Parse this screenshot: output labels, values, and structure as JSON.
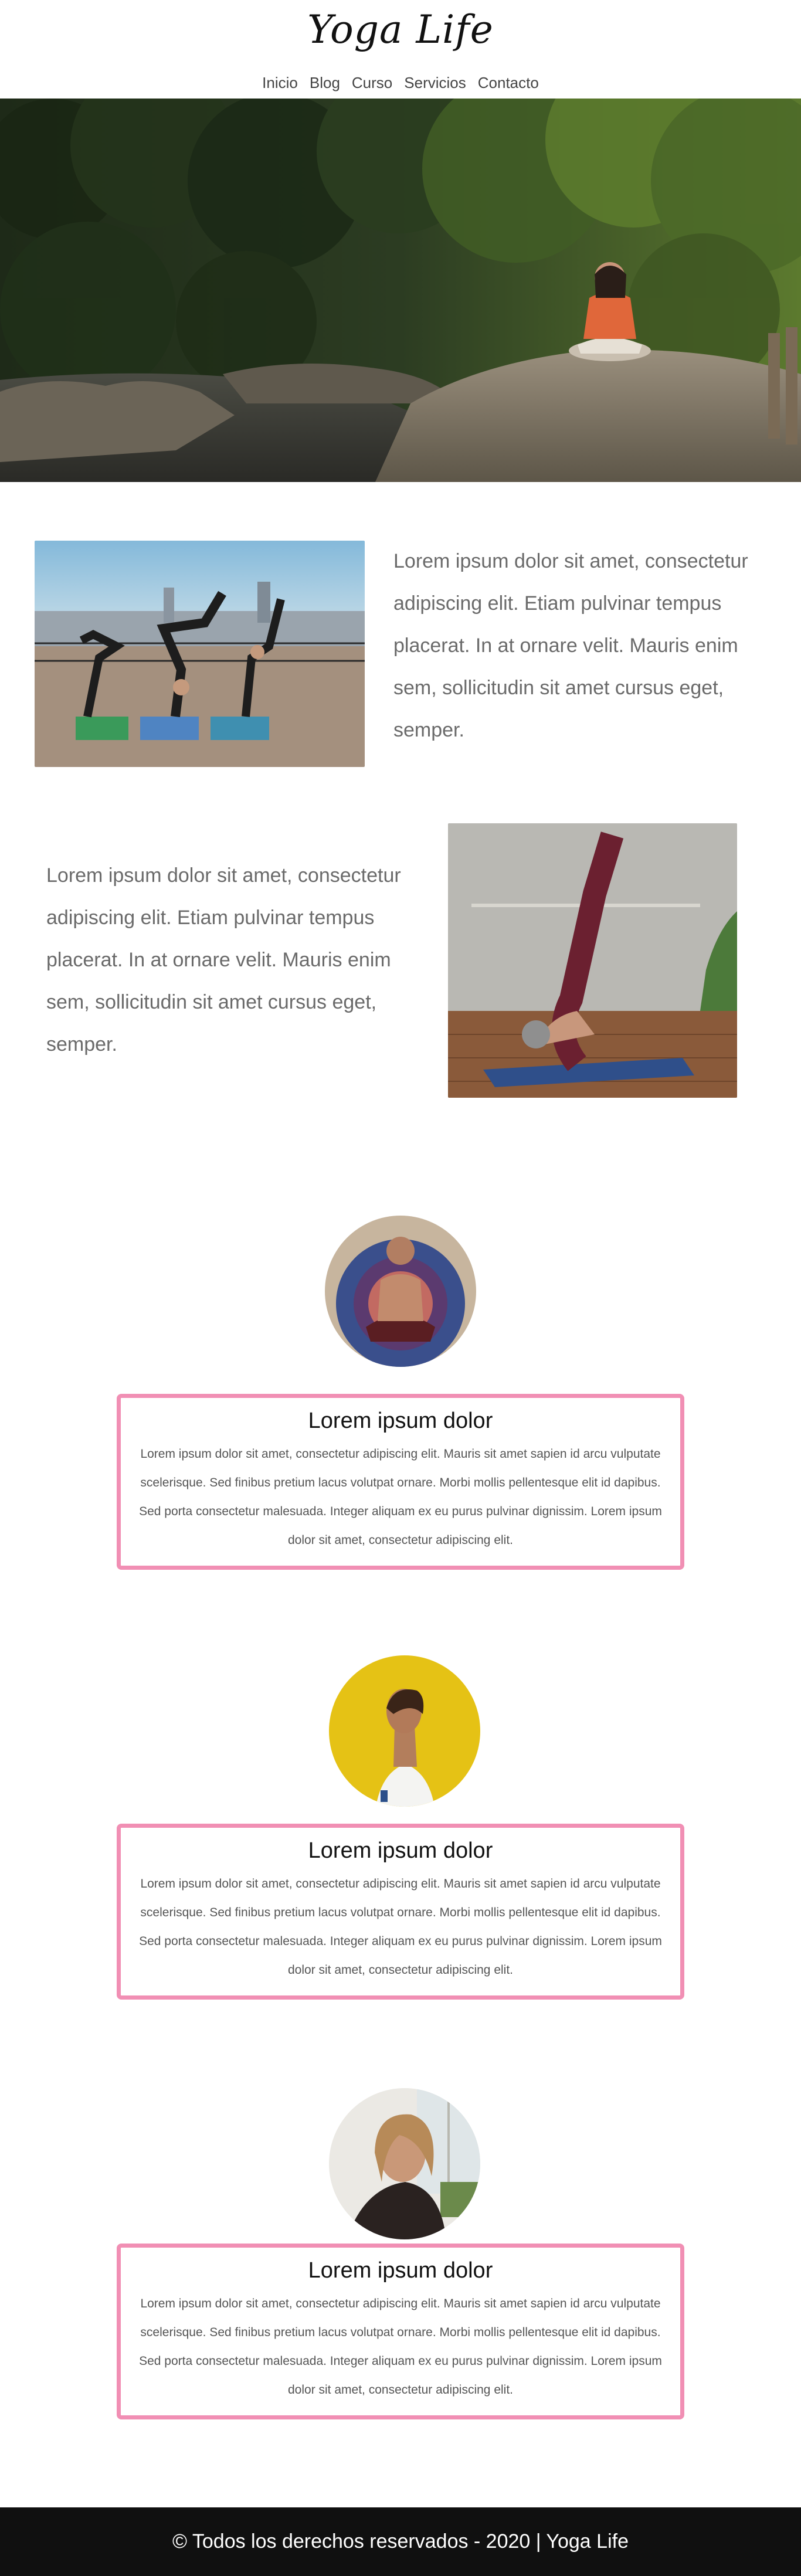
{
  "header": {
    "brand": "Yoga Life",
    "nav": [
      "Inicio",
      "Blog",
      "Curso",
      "Servicios",
      "Contacto"
    ]
  },
  "features": [
    {
      "text": "Lorem ipsum dolor sit amet, consectetur adipiscing elit. Etiam pulvinar tempus placerat. In at ornare velit. Mauris enim sem, sollicitudin sit amet cursus eget, semper."
    },
    {
      "text": "Lorem ipsum dolor sit amet, consectetur adipiscing elit. Etiam pulvinar tempus placerat. In at ornare velit. Mauris enim sem, sollicitudin sit amet cursus eget, semper."
    }
  ],
  "cards": [
    {
      "title": "Lorem ipsum dolor",
      "body": "Lorem ipsum dolor sit amet, consectetur adipiscing elit. Mauris sit amet sapien id arcu vulputate scelerisque. Sed finibus pretium lacus volutpat ornare. Morbi mollis pellentesque elit id dapibus. Sed porta consectetur malesuada. Integer aliquam ex eu purus pulvinar dignissim. Lorem ipsum dolor sit amet, consectetur adipiscing elit."
    },
    {
      "title": "Lorem ipsum dolor",
      "body": "Lorem ipsum dolor sit amet, consectetur adipiscing elit. Mauris sit amet sapien id arcu vulputate scelerisque. Sed finibus pretium lacus volutpat ornare. Morbi mollis pellentesque elit id dapibus. Sed porta consectetur malesuada. Integer aliquam ex eu purus pulvinar dignissim. Lorem ipsum dolor sit amet, consectetur adipiscing elit."
    },
    {
      "title": "Lorem ipsum dolor",
      "body": "Lorem ipsum dolor sit amet, consectetur adipiscing elit. Mauris sit amet sapien id arcu vulputate scelerisque. Sed finibus pretium lacus volutpat ornare. Morbi mollis pellentesque elit id dapibus. Sed porta consectetur malesuada. Integer aliquam ex eu purus pulvinar dignissim. Lorem ipsum dolor sit amet, consectetur adipiscing elit."
    }
  ],
  "footer": {
    "text": "© Todos los derechos reservados - 2020 | Yoga Life"
  },
  "colors": {
    "card_border": "#f18fb4",
    "footer_bg": "#101010",
    "text": "#6a6a6a"
  }
}
